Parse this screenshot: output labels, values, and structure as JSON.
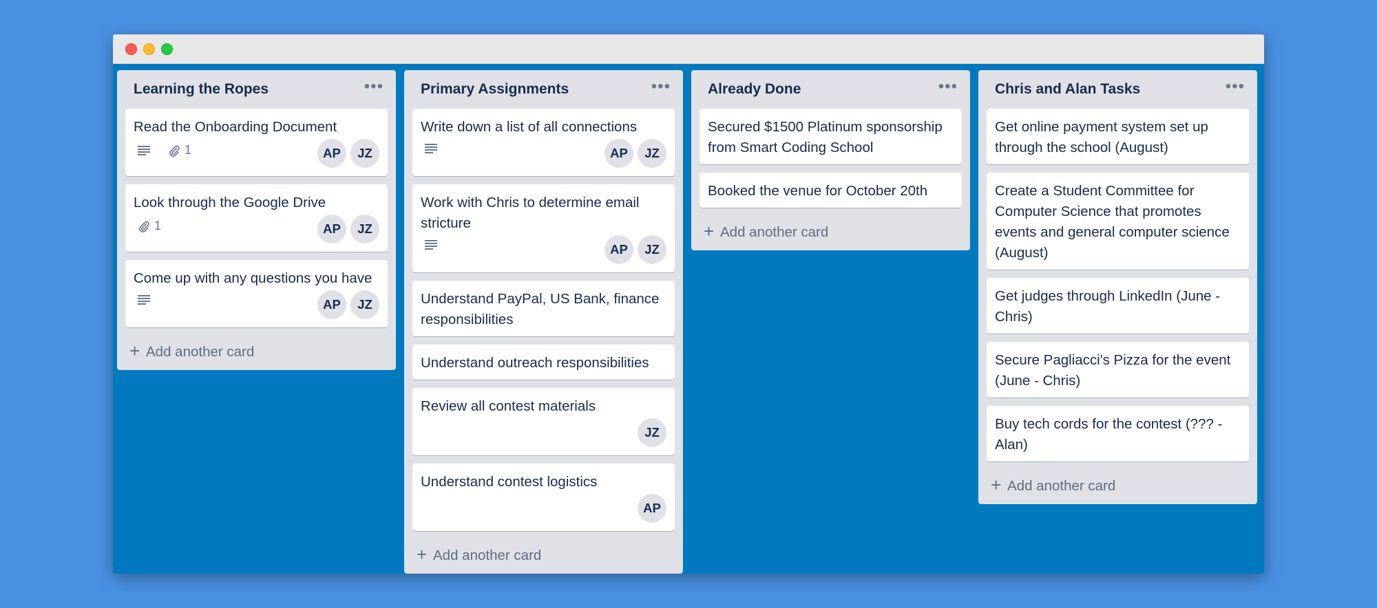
{
  "colors": {
    "page_bg": "#4a90e2",
    "board_bg": "#0079bf",
    "list_bg": "#dfe1e6",
    "card_bg": "#ffffff"
  },
  "lists": [
    {
      "title": "Learning the Ropes",
      "add_label": "Add another card",
      "cards": [
        {
          "title": "Read the Onboarding Document",
          "description_icon": true,
          "attachments": "1",
          "members": [
            "AP",
            "JZ"
          ]
        },
        {
          "title": "Look through the Google Drive",
          "description_icon": false,
          "attachments": "1",
          "members": [
            "AP",
            "JZ"
          ]
        },
        {
          "title": "Come up with any questions you have",
          "description_icon": true,
          "attachments": null,
          "members": [
            "AP",
            "JZ"
          ]
        }
      ]
    },
    {
      "title": "Primary Assignments",
      "add_label": "Add another card",
      "cards": [
        {
          "title": "Write down a list of all connections",
          "description_icon": true,
          "attachments": null,
          "members": [
            "AP",
            "JZ"
          ]
        },
        {
          "title": "Work with Chris to determine email stricture",
          "description_icon": true,
          "attachments": null,
          "members": [
            "AP",
            "JZ"
          ]
        },
        {
          "title": "Understand PayPal, US Bank, finance responsibilities",
          "description_icon": false,
          "attachments": null,
          "members": []
        },
        {
          "title": "Understand outreach responsibilities",
          "description_icon": false,
          "attachments": null,
          "members": []
        },
        {
          "title": "Review all contest materials",
          "description_icon": false,
          "attachments": null,
          "members": [
            "JZ"
          ]
        },
        {
          "title": "Understand contest logistics",
          "description_icon": false,
          "attachments": null,
          "members": [
            "AP"
          ]
        }
      ]
    },
    {
      "title": "Already Done",
      "add_label": "Add another card",
      "cards": [
        {
          "title": "Secured $1500 Platinum sponsorship from Smart Coding School",
          "description_icon": false,
          "attachments": null,
          "members": []
        },
        {
          "title": "Booked the venue for October 20th",
          "description_icon": false,
          "attachments": null,
          "members": []
        }
      ]
    },
    {
      "title": "Chris and Alan Tasks",
      "add_label": "Add another card",
      "cards": [
        {
          "title": "Get online payment system set up through the school (August)",
          "description_icon": false,
          "attachments": null,
          "members": []
        },
        {
          "title": "Create a Student Committee for Computer Science that promotes events and general computer science (August)",
          "description_icon": false,
          "attachments": null,
          "members": []
        },
        {
          "title": "Get judges through LinkedIn (June - Chris)",
          "description_icon": false,
          "attachments": null,
          "members": []
        },
        {
          "title": "Secure Pagliacci's Pizza for the event (June - Chris)",
          "description_icon": false,
          "attachments": null,
          "members": []
        },
        {
          "title": "Buy tech cords for the contest (??? - Alan)",
          "description_icon": false,
          "attachments": null,
          "members": []
        }
      ]
    }
  ]
}
